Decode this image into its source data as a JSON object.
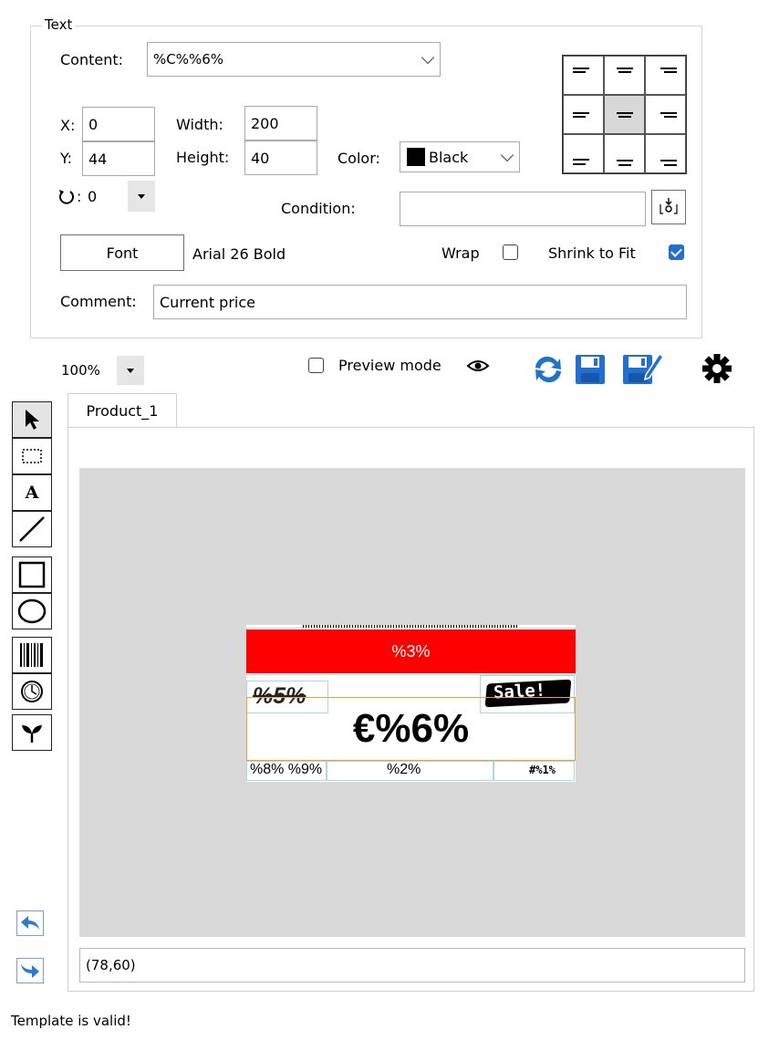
{
  "text_panel": {
    "group_title": "Text",
    "content_label": "Content:",
    "content_value": "%C%%6%",
    "x_label": "X:",
    "x_value": "0",
    "y_label": "Y:",
    "y_value": "44",
    "width_label": "Width:",
    "width_value": "200",
    "height_label": "Height:",
    "height_value": "40",
    "color_label": "Color:",
    "color_value": "Black",
    "color_swatch": "#000000",
    "rotation_value": "0",
    "condition_label": "Condition:",
    "condition_value": "",
    "font_button": "Font",
    "font_value": "Arial 26 Bold",
    "wrap_label": "Wrap",
    "wrap_checked": false,
    "shrink_label": "Shrink to Fit",
    "shrink_checked": true,
    "comment_label": "Comment:",
    "comment_value": "Current price",
    "alignment_selected": "middle-center"
  },
  "toolbar": {
    "zoom_value": "100%",
    "preview_label": "Preview mode",
    "preview_checked": false
  },
  "canvas": {
    "tab_label": "Product_1",
    "label_banner_text": "%3%",
    "label_banner_color": "#ff0000",
    "old_price_text": "%5%",
    "sale_text": "Sale!",
    "price_text": "€%6%",
    "footer_left": "%8% %9%",
    "footer_mid": "%2%",
    "footer_right": "#%1%",
    "selection_color": "#f0a030",
    "coords": "(78,60)"
  },
  "status": {
    "message": "Template is valid!"
  }
}
